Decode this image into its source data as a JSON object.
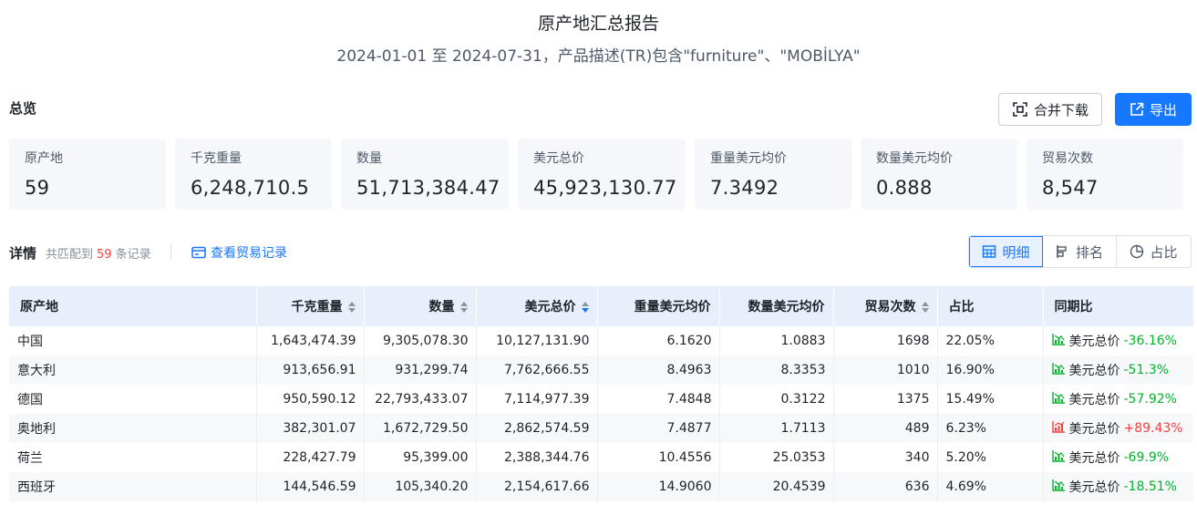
{
  "report": {
    "title": "原产地汇总报告",
    "subtitle": "2024-01-01 至 2024-07-31，产品描述(TR)包含\"furniture\"、\"MOBİLYA\""
  },
  "overview": {
    "title": "总览",
    "merge_download_label": "合并下载",
    "export_label": "导出",
    "stats": [
      {
        "label": "原产地",
        "value": "59"
      },
      {
        "label": "千克重量",
        "value": "6,248,710.5"
      },
      {
        "label": "数量",
        "value": "51,713,384.47"
      },
      {
        "label": "美元总价",
        "value": "45,923,130.77"
      },
      {
        "label": "重量美元均价",
        "value": "7.3492"
      },
      {
        "label": "数量美元均价",
        "value": "0.888"
      },
      {
        "label": "贸易次数",
        "value": "8,547"
      }
    ]
  },
  "detail": {
    "title": "详情",
    "match_prefix": "共匹配到",
    "match_count": "59",
    "match_suffix": "条记录",
    "view_records_label": "查看贸易记录",
    "views": {
      "detail": "明细",
      "rank": "排名",
      "share": "占比"
    }
  },
  "table": {
    "columns": {
      "origin": "原产地",
      "weight": "千克重量",
      "quantity": "数量",
      "total_usd": "美元总价",
      "weight_avg": "重量美元均价",
      "qty_avg": "数量美元均价",
      "trades": "贸易次数",
      "share": "占比",
      "yoy": "同期比"
    },
    "rows": [
      {
        "origin": "中国",
        "weight": "1,643,474.39",
        "quantity": "9,305,078.30",
        "total_usd": "10,127,131.90",
        "weight_avg": "6.1620",
        "qty_avg": "1.0883",
        "trades": "1698",
        "share": "22.05%",
        "yoy_label": "美元总价",
        "yoy_value": "-36.16%",
        "trend": "down"
      },
      {
        "origin": "意大利",
        "weight": "913,656.91",
        "quantity": "931,299.74",
        "total_usd": "7,762,666.55",
        "weight_avg": "8.4963",
        "qty_avg": "8.3353",
        "trades": "1010",
        "share": "16.90%",
        "yoy_label": "美元总价",
        "yoy_value": "-51.3%",
        "trend": "down"
      },
      {
        "origin": "德国",
        "weight": "950,590.12",
        "quantity": "22,793,433.07",
        "total_usd": "7,114,977.39",
        "weight_avg": "7.4848",
        "qty_avg": "0.3122",
        "trades": "1375",
        "share": "15.49%",
        "yoy_label": "美元总价",
        "yoy_value": "-57.92%",
        "trend": "down"
      },
      {
        "origin": "奥地利",
        "weight": "382,301.07",
        "quantity": "1,672,729.50",
        "total_usd": "2,862,574.59",
        "weight_avg": "7.4877",
        "qty_avg": "1.7113",
        "trades": "489",
        "share": "6.23%",
        "yoy_label": "美元总价",
        "yoy_value": "+89.43%",
        "trend": "up"
      },
      {
        "origin": "荷兰",
        "weight": "228,427.79",
        "quantity": "95,399.00",
        "total_usd": "2,388,344.76",
        "weight_avg": "10.4556",
        "qty_avg": "25.0353",
        "trades": "340",
        "share": "5.20%",
        "yoy_label": "美元总价",
        "yoy_value": "-69.9%",
        "trend": "down"
      },
      {
        "origin": "西班牙",
        "weight": "144,546.59",
        "quantity": "105,340.20",
        "total_usd": "2,154,617.66",
        "weight_avg": "14.9060",
        "qty_avg": "20.4539",
        "trades": "636",
        "share": "4.69%",
        "yoy_label": "美元总价",
        "yoy_value": "-18.51%",
        "trend": "down"
      }
    ]
  },
  "colors": {
    "accent": "#1677ff",
    "down": "#00b42a",
    "up": "#f53f3f",
    "header_bg": "#e8effa"
  },
  "icons": {
    "merge": "merge-grid-icon",
    "export": "external-link-icon",
    "records": "card-icon",
    "detail": "table-icon",
    "rank": "bar-rank-icon",
    "share": "pie-icon",
    "trend_down": "trend-down-chart-icon",
    "trend_up": "trend-up-chart-icon"
  }
}
